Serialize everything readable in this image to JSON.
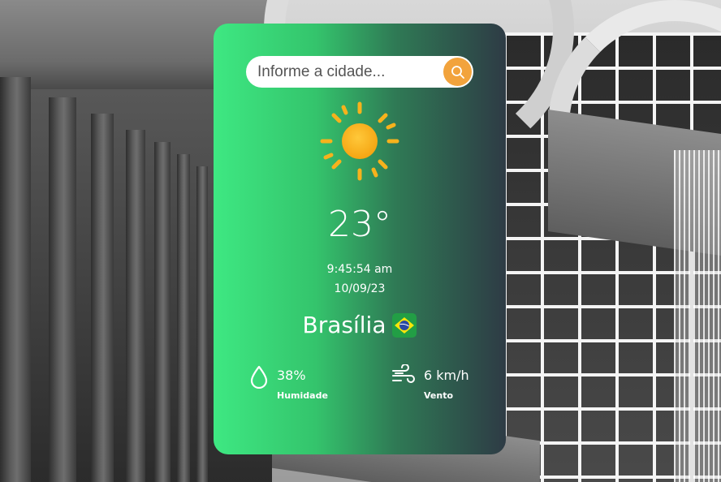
{
  "search": {
    "placeholder": "Informe a cidade...",
    "value": ""
  },
  "weather": {
    "icon": "sun-icon",
    "temperature": "23°",
    "time": "9:45:54 am",
    "date": "10/09/23",
    "city": "Brasília",
    "country_flag": "brazil-flag-icon"
  },
  "stats": {
    "humidity": {
      "value": "38%",
      "label": "Humidade",
      "icon": "droplet-icon"
    },
    "wind": {
      "value": "6 km/h",
      "label": "Vento",
      "icon": "wind-icon"
    }
  },
  "colors": {
    "card_gradient_start": "#3ee882",
    "card_gradient_end": "#2e3b45",
    "accent": "#f2a33c",
    "sun": "#f7b21c",
    "text": "#ffffff"
  }
}
